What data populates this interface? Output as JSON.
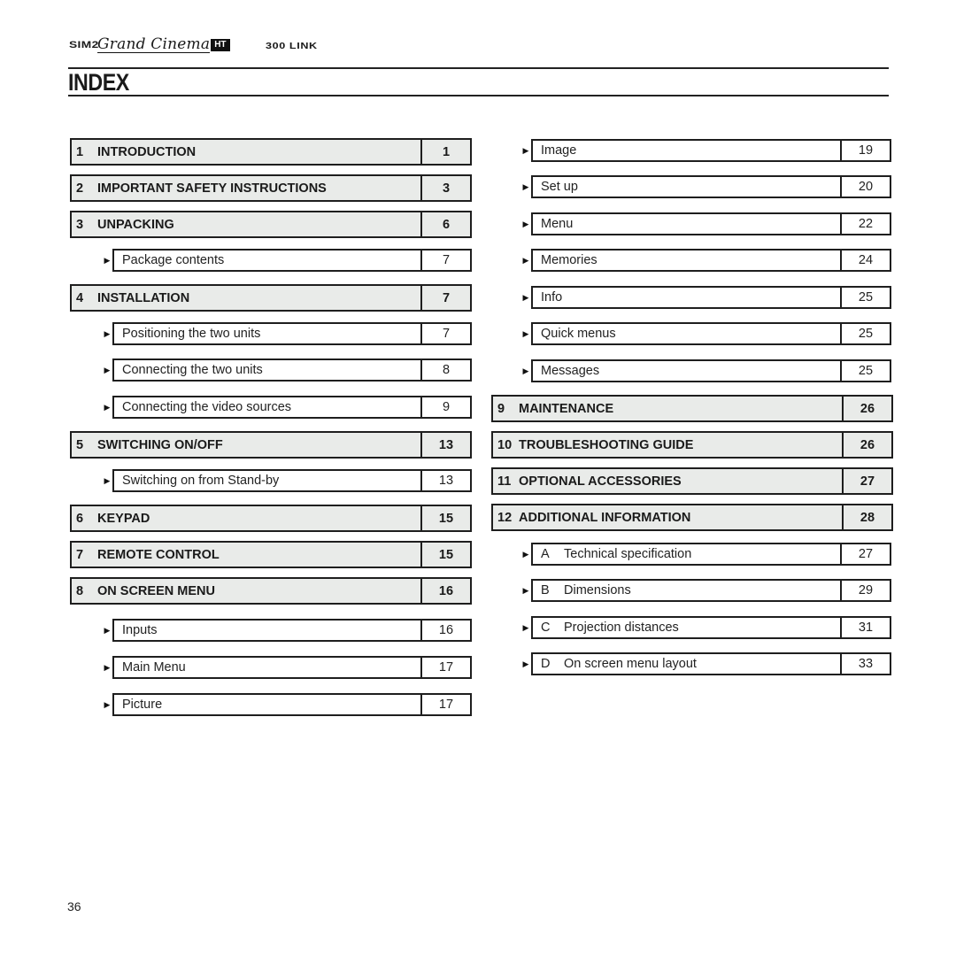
{
  "header": {
    "brand_sim2": "SIM2",
    "brand_script": "Grand Cinema",
    "brand_badge": "HT",
    "model": "300 LINK",
    "title": "INDEX"
  },
  "left_column": [
    {
      "type": "section",
      "num": "1",
      "label": "INTRODUCTION",
      "page": "1"
    },
    {
      "type": "section",
      "num": "2",
      "label": "IMPORTANT SAFETY INSTRUCTIONS",
      "page": "3"
    },
    {
      "type": "section",
      "num": "3",
      "label": "UNPACKING",
      "page": "6"
    },
    {
      "type": "sub",
      "letter": "",
      "label": "Package contents",
      "page": "7"
    },
    {
      "type": "section",
      "num": "4",
      "label": "INSTALLATION",
      "page": "7"
    },
    {
      "type": "sub",
      "letter": "",
      "label": "Positioning the two units",
      "page": "7"
    },
    {
      "type": "sub",
      "letter": "",
      "label": "Connecting the two units",
      "page": "8"
    },
    {
      "type": "sub",
      "letter": "",
      "label": "Connecting the video sources",
      "page": "9"
    },
    {
      "type": "section",
      "num": "5",
      "label": "SWITCHING ON/OFF",
      "page": "13"
    },
    {
      "type": "sub",
      "letter": "",
      "label": "Switching on from Stand-by",
      "page": "13"
    },
    {
      "type": "section",
      "num": "6",
      "label": "KEYPAD",
      "page": "15"
    },
    {
      "type": "section",
      "num": "7",
      "label": "REMOTE CONTROL",
      "page": "15"
    },
    {
      "type": "section",
      "num": "8",
      "label": "ON SCREEN MENU",
      "page": "16"
    },
    {
      "type": "sub",
      "letter": "",
      "label": "Inputs",
      "page": "16"
    },
    {
      "type": "sub",
      "letter": "",
      "label": "Main Menu",
      "page": "17"
    },
    {
      "type": "sub",
      "letter": "",
      "label": "Picture",
      "page": "17"
    }
  ],
  "right_column": [
    {
      "type": "sub",
      "letter": "",
      "label": "Image",
      "page": "19"
    },
    {
      "type": "sub",
      "letter": "",
      "label": "Set up",
      "page": "20"
    },
    {
      "type": "sub",
      "letter": "",
      "label": "Menu",
      "page": "22"
    },
    {
      "type": "sub",
      "letter": "",
      "label": "Memories",
      "page": "24"
    },
    {
      "type": "sub",
      "letter": "",
      "label": "Info",
      "page": "25"
    },
    {
      "type": "sub",
      "letter": "",
      "label": "Quick menus",
      "page": "25"
    },
    {
      "type": "sub",
      "letter": "",
      "label": "Messages",
      "page": "25"
    },
    {
      "type": "section",
      "num": "9",
      "label": "MAINTENANCE",
      "page": "26"
    },
    {
      "type": "section",
      "num": "10",
      "label": "TROUBLESHOOTING GUIDE",
      "page": "26"
    },
    {
      "type": "section",
      "num": "11",
      "label": "OPTIONAL ACCESSORIES",
      "page": "27"
    },
    {
      "type": "section",
      "num": "12",
      "label": "ADDITIONAL INFORMATION",
      "page": "28"
    },
    {
      "type": "sub",
      "letter": "A",
      "label": "Technical specification",
      "page": "27"
    },
    {
      "type": "sub",
      "letter": "B",
      "label": "Dimensions",
      "page": "29"
    },
    {
      "type": "sub",
      "letter": "C",
      "label": "Projection distances",
      "page": "31"
    },
    {
      "type": "sub",
      "letter": "D",
      "label": "On screen menu layout",
      "page": "33"
    }
  ],
  "icons": {
    "bullet": "arrow-right-icon",
    "bullet_glyph": "▶"
  },
  "footer": {
    "page_number": "36"
  }
}
